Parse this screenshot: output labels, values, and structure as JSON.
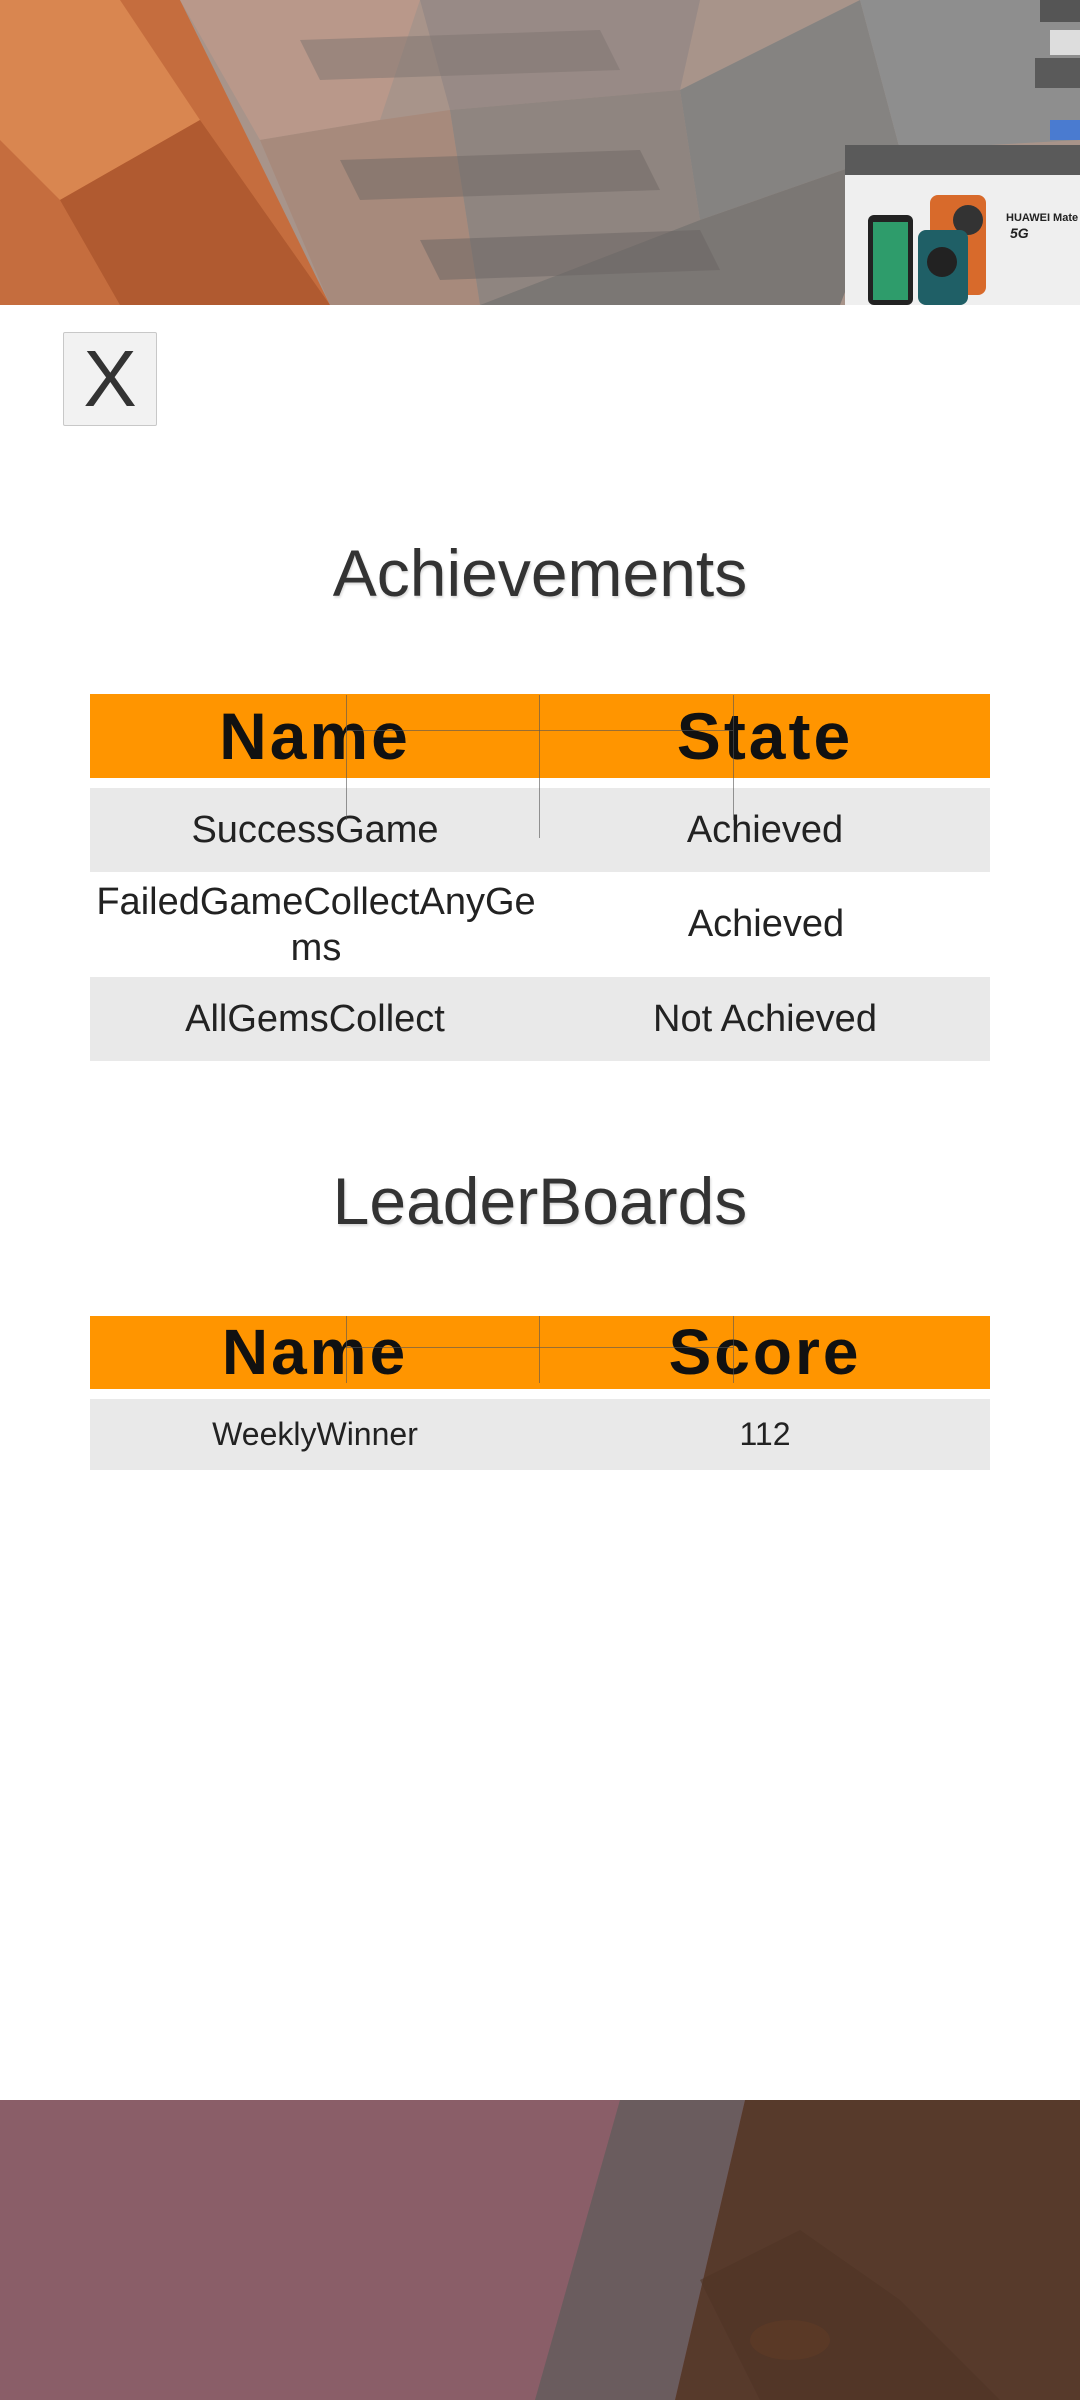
{
  "close_button": {
    "label": "X"
  },
  "achievements": {
    "title": "Achievements",
    "columns": [
      "Name",
      "State"
    ],
    "rows": [
      {
        "name": "SuccessGame",
        "state": "Achieved"
      },
      {
        "name": "FailedGameCollectAnyGems",
        "state": "Achieved"
      },
      {
        "name": "AllGemsCollect",
        "state": "Not Achieved"
      }
    ]
  },
  "leaderboards": {
    "title": "LeaderBoards",
    "columns": [
      "Name",
      "Score"
    ],
    "rows": [
      {
        "name": "WeeklyWinner",
        "score": "112"
      }
    ]
  },
  "ad_banner": {
    "brand": "HUAWEI Mate",
    "tag": "5G"
  },
  "colors": {
    "header_accent": "#ff9500",
    "row_gray": "#e9e9e9"
  }
}
